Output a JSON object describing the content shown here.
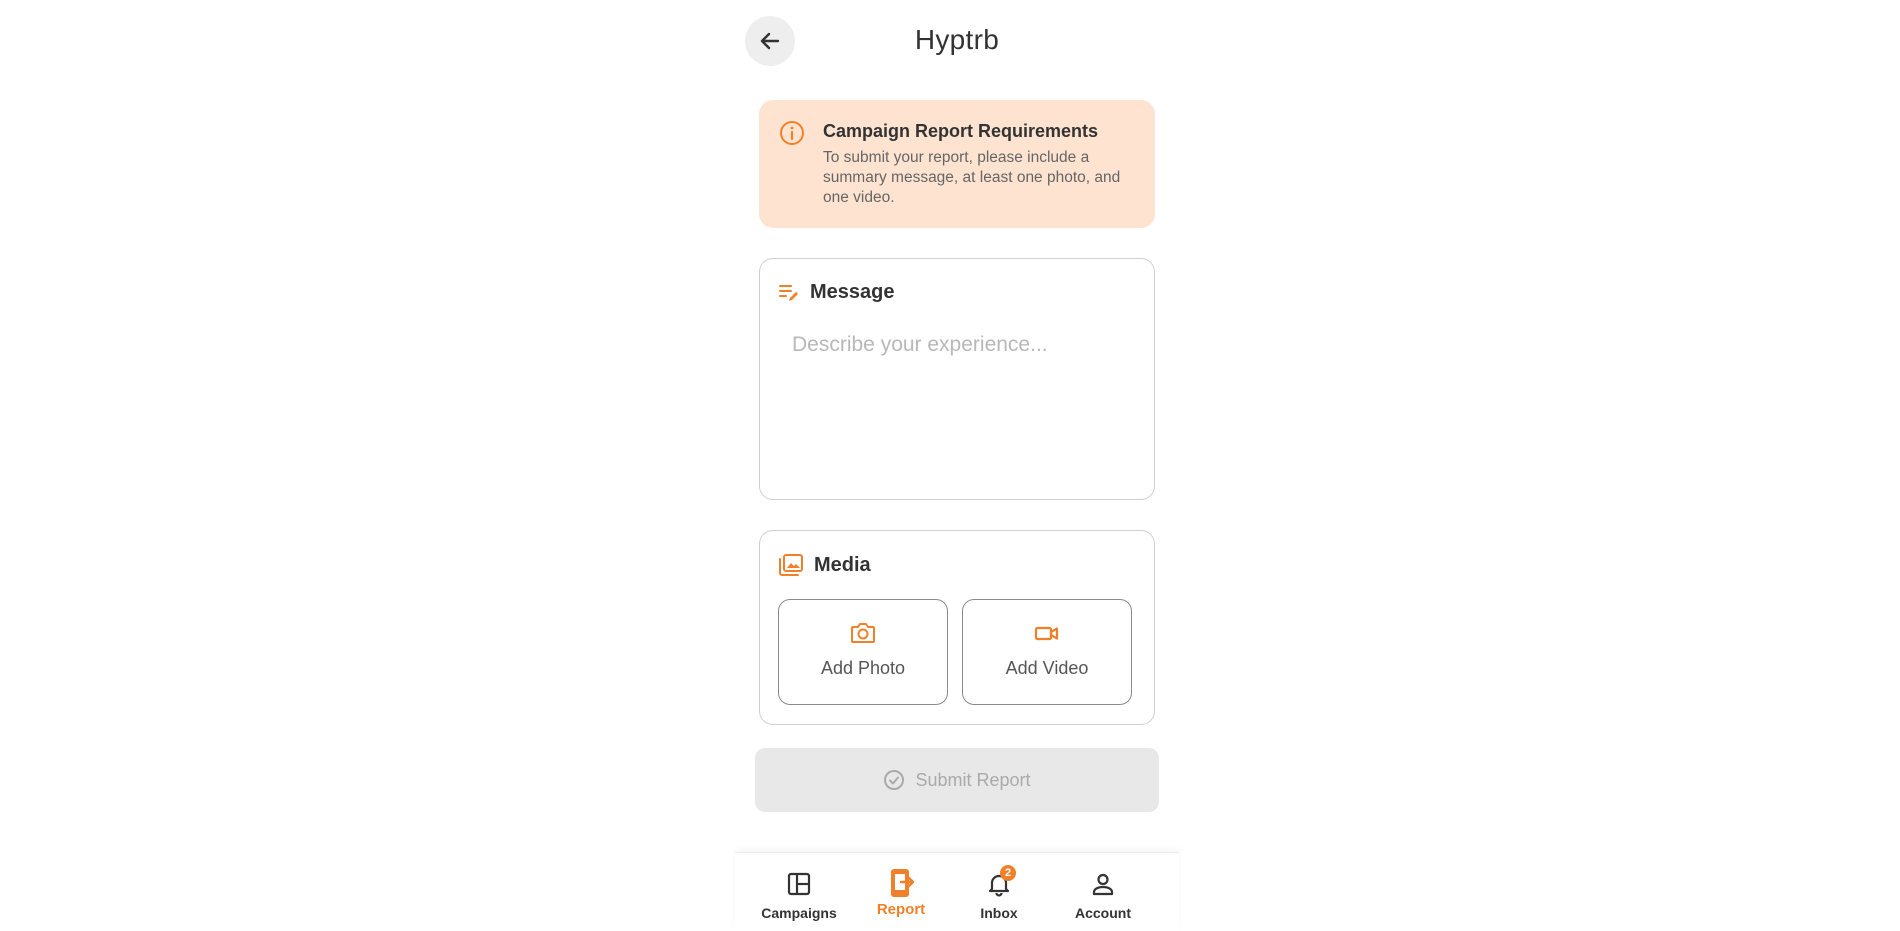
{
  "header": {
    "title": "Hyptrb",
    "back_icon": "arrow-left-icon"
  },
  "requirements": {
    "title": "Campaign Report Requirements",
    "text": "To submit your report, please include a summary message, at least one photo, and one video.",
    "icon": "info-circle-icon"
  },
  "message": {
    "label": "Message",
    "icon": "edit-notes-icon",
    "value": "",
    "placeholder": "Describe your experience..."
  },
  "media": {
    "label": "Media",
    "icon": "photo-library-icon",
    "add_photo": "Add Photo",
    "add_video": "Add Video"
  },
  "submit": {
    "label": "Submit Report",
    "icon": "check-circle-icon",
    "enabled": false
  },
  "bottom_nav": {
    "items": [
      {
        "label": "Campaigns",
        "icon": "dashboard-icon"
      },
      {
        "label": "Report",
        "icon": "report-upload-icon",
        "active": true
      },
      {
        "label": "Inbox",
        "icon": "bell-icon",
        "badge": "2"
      },
      {
        "label": "Account",
        "icon": "person-icon"
      }
    ]
  },
  "colors": {
    "accent": "#f0812a",
    "banner_bg": "#fde3d0",
    "disabled_bg": "#e8e8e8",
    "disabled_text": "#aaaaaa"
  }
}
